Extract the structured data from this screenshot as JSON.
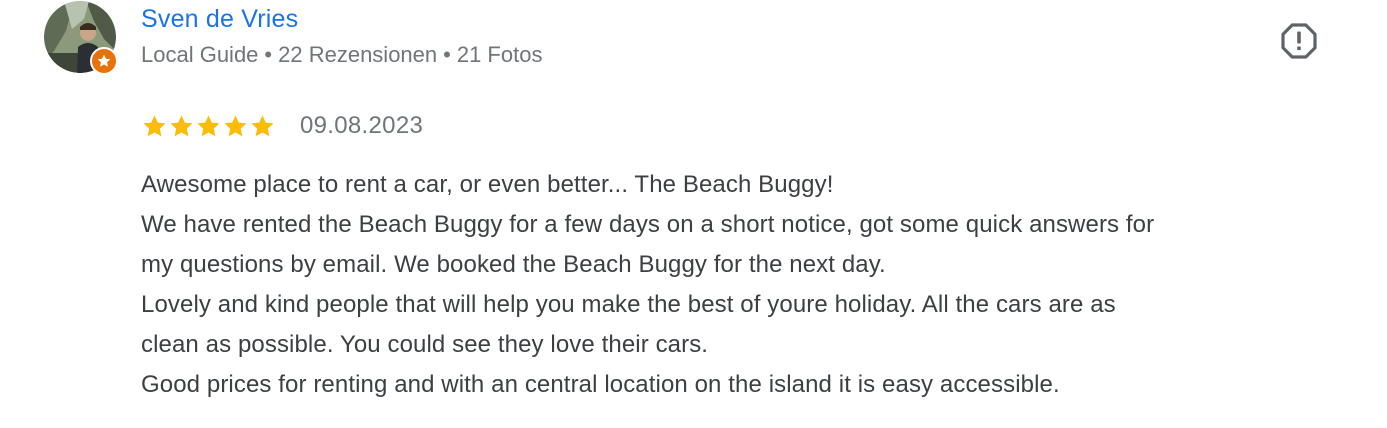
{
  "review": {
    "author": {
      "name": "Sven de Vries",
      "role": "Local Guide",
      "reviews_count": "22 Rezensionen",
      "photos_count": "21 Fotos",
      "separator": "•",
      "avatar_icon": "user-photo",
      "badge_icon": "local-guide-star-icon"
    },
    "report_icon": "report-octagon-icon",
    "rating": 5,
    "rating_max": 5,
    "date": "09.08.2023",
    "text_lines": [
      "Awesome place to rent a car, or even better... The Beach Buggy!",
      "We have rented the Beach Buggy for a few days on a short notice, got some quick answers for",
      "my questions by email. We booked the Beach Buggy for the next day.",
      "Lovely and kind people that will help you make the best of youre holiday. All the cars are as",
      "clean as possible. You could see they love their cars.",
      "Good prices for renting and with an central location on the island it is easy accessible."
    ]
  },
  "colors": {
    "author_link": "#1a73e8",
    "meta_text": "#70757a",
    "body_text": "#3c4043",
    "star": "#fbbc04",
    "badge": "#e8710a",
    "report_icon": "#5f6368"
  }
}
